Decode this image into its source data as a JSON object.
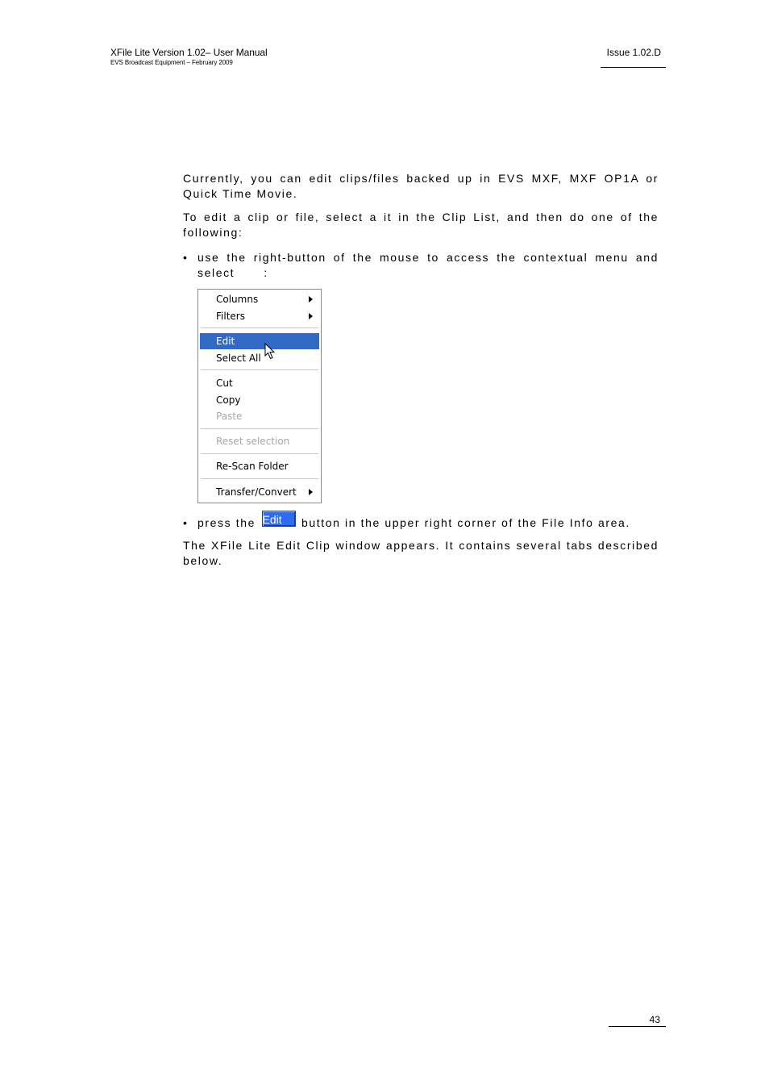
{
  "header": {
    "title": "XFile Lite Version 1.02– User Manual",
    "subtitle": "EVS Broadcast Equipment – February 2009",
    "issue": "Issue 1.02.D"
  },
  "body": {
    "para1": "Currently, you can edit clips/files backed up in EVS MXF, MXF OP1A or Quick Time Movie.",
    "para2": "To edit a clip or file, select a it in the Clip List, and then do one of the following:",
    "bullet1_text": "use the right-button of the mouse to access the contextual menu and",
    "bullet1_select": "select",
    "bullet1_colon": ":",
    "bullet2_before": "press the",
    "edit_button_label": "Edit",
    "bullet2_after": "button in the upper right corner of the File Info area.",
    "para4": "The XFile Lite Edit Clip window appears. It contains several tabs described below."
  },
  "context_menu": {
    "items": [
      {
        "label": "Columns",
        "has_submenu": true,
        "disabled": false
      },
      {
        "label": "Filters",
        "has_submenu": true,
        "disabled": false
      },
      {
        "label": "Edit",
        "highlighted": true,
        "disabled": false
      },
      {
        "label": "Select All",
        "disabled": false
      },
      {
        "label": "Cut",
        "disabled": false
      },
      {
        "label": "Copy",
        "disabled": false
      },
      {
        "label": "Paste",
        "disabled": true
      },
      {
        "label": "Reset selection",
        "disabled": true
      },
      {
        "label": "Re-Scan Folder",
        "disabled": false
      },
      {
        "label": "Transfer/Convert",
        "has_submenu": true,
        "disabled": false
      }
    ],
    "highlight_color": "#316ac5",
    "disabled_color": "#a7a7a7"
  },
  "footer": {
    "page_number": "43"
  }
}
